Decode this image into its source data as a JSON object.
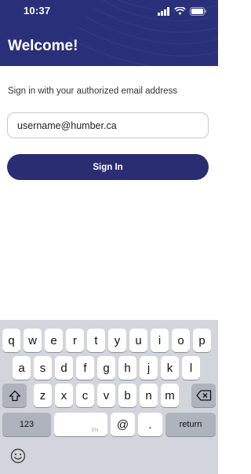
{
  "status_bar": {
    "time": "10:37"
  },
  "header": {
    "title": "Welcome!"
  },
  "form": {
    "subtitle": "Sign in with your authorized email address",
    "email_value": "username@humber.ca",
    "signin_label": "Sign In"
  },
  "keyboard": {
    "row1": [
      "q",
      "w",
      "e",
      "r",
      "t",
      "y",
      "u",
      "i",
      "o",
      "p"
    ],
    "row2": [
      "a",
      "s",
      "d",
      "f",
      "g",
      "h",
      "j",
      "k",
      "l"
    ],
    "row3": [
      "z",
      "x",
      "c",
      "v",
      "b",
      "n",
      "m"
    ],
    "numbers_label": "123",
    "space_hint": "EN",
    "at_label": "@",
    "dot_label": ".",
    "return_label": "return",
    "shift_icon": "shift-icon",
    "backspace_icon": "backspace-icon",
    "emoji_icon": "emoji-icon"
  },
  "colors": {
    "header": "#2a2f7a",
    "button": "#2b2d72",
    "keyboard_bg": "#d2d5db"
  }
}
